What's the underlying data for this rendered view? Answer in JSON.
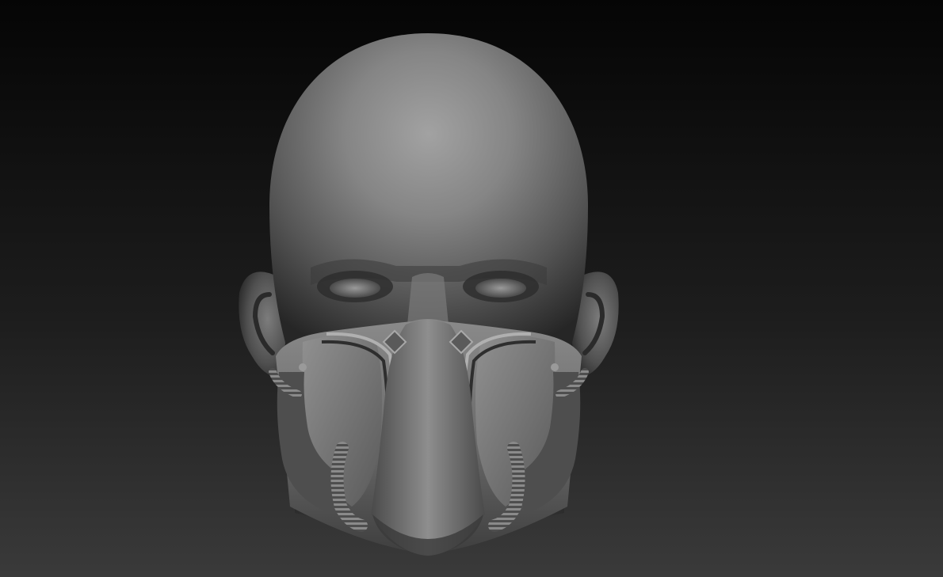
{
  "scene": {
    "subject": "sculpted-head-with-mask",
    "background_colors": {
      "top": "#050505",
      "bottom": "#3a3a3a"
    },
    "material_colors": {
      "highlight": "#a8a8a8",
      "mid": "#6e6e6e",
      "shadow": "#1e1e1e"
    }
  }
}
